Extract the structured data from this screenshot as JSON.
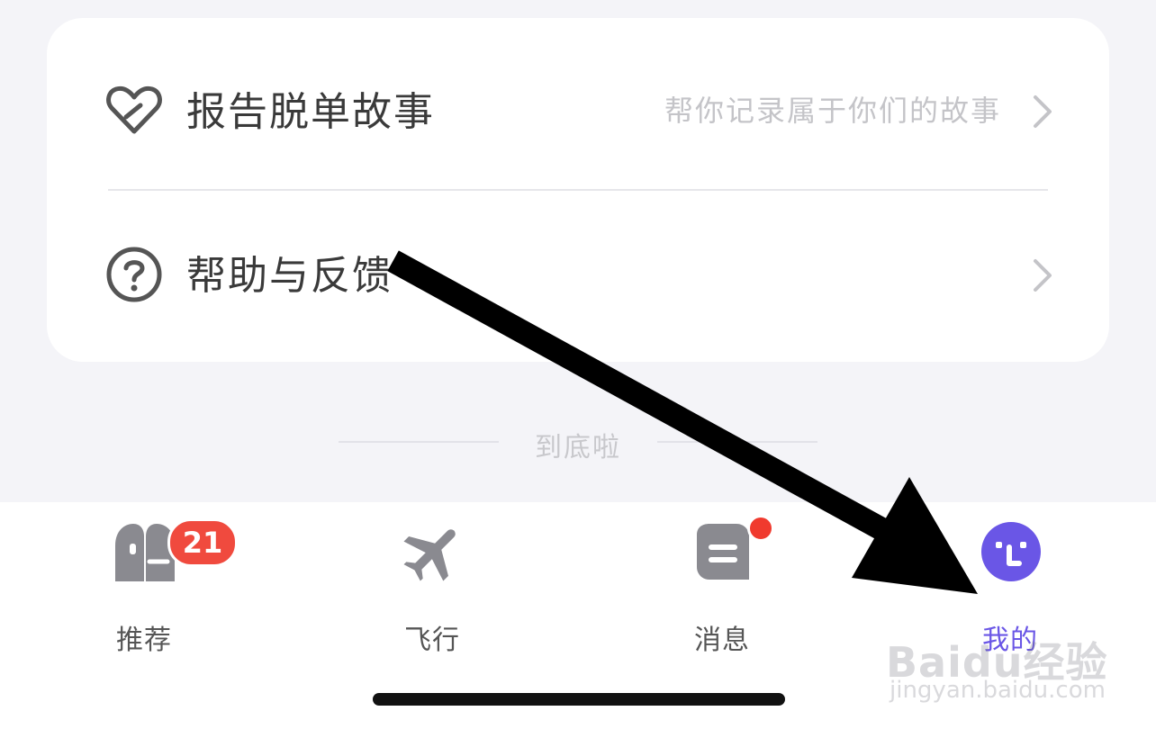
{
  "menu": {
    "items": [
      {
        "label": "报告脱单故事",
        "hint": "帮你记录属于你们的故事",
        "icon": "heart-icon"
      },
      {
        "label": "帮助与反馈",
        "hint": "",
        "icon": "question-circle-icon"
      }
    ]
  },
  "footer_note": "到底啦",
  "tabbar": {
    "tabs": [
      {
        "label": "推荐",
        "icon": "recommend-icon",
        "badge": "21"
      },
      {
        "label": "飞行",
        "icon": "airplane-icon"
      },
      {
        "label": "消息",
        "icon": "message-icon",
        "dot": true
      },
      {
        "label": "我的",
        "icon": "profile-face-icon",
        "active": true
      }
    ]
  },
  "colors": {
    "accent": "#6a56e6",
    "badge": "#f04a3e",
    "background": "#f4f4f8"
  },
  "watermark": {
    "logo": "Baidu经验",
    "url": "jingyan.baidu.com"
  }
}
